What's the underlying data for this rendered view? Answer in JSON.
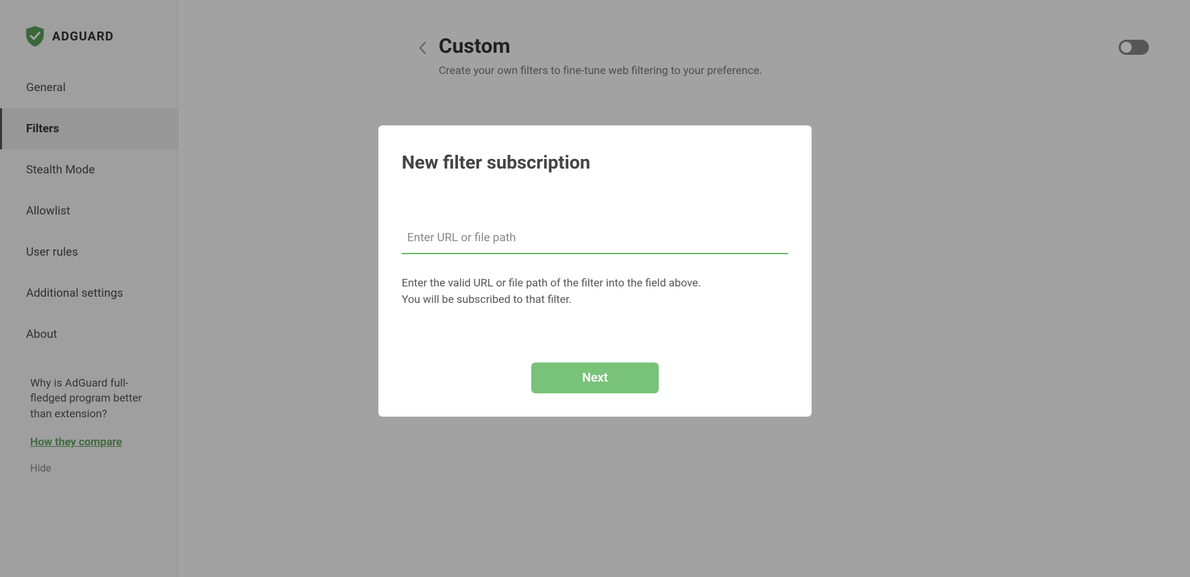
{
  "brand": {
    "name": "ADGUARD"
  },
  "sidebar": {
    "items": [
      {
        "label": "General"
      },
      {
        "label": "Filters"
      },
      {
        "label": "Stealth Mode"
      },
      {
        "label": "Allowlist"
      },
      {
        "label": "User rules"
      },
      {
        "label": "Additional settings"
      },
      {
        "label": "About"
      }
    ],
    "active_index": 1,
    "promo": {
      "text": "Why is AdGuard full-fledged program better than extension?",
      "link_label": "How they compare",
      "hide_label": "Hide"
    }
  },
  "page": {
    "title": "Custom",
    "subtitle": "Create your own filters to fine-tune web filtering to your preference.",
    "toggle_on": false
  },
  "modal": {
    "title": "New filter subscription",
    "input_placeholder": "Enter URL or file path",
    "input_value": "",
    "help_line1": "Enter the valid URL or file path of the filter into the field above.",
    "help_line2": "You will be subscribed to that filter.",
    "next_label": "Next"
  },
  "colors": {
    "accent": "#68bb6a",
    "button": "#78c27a"
  }
}
